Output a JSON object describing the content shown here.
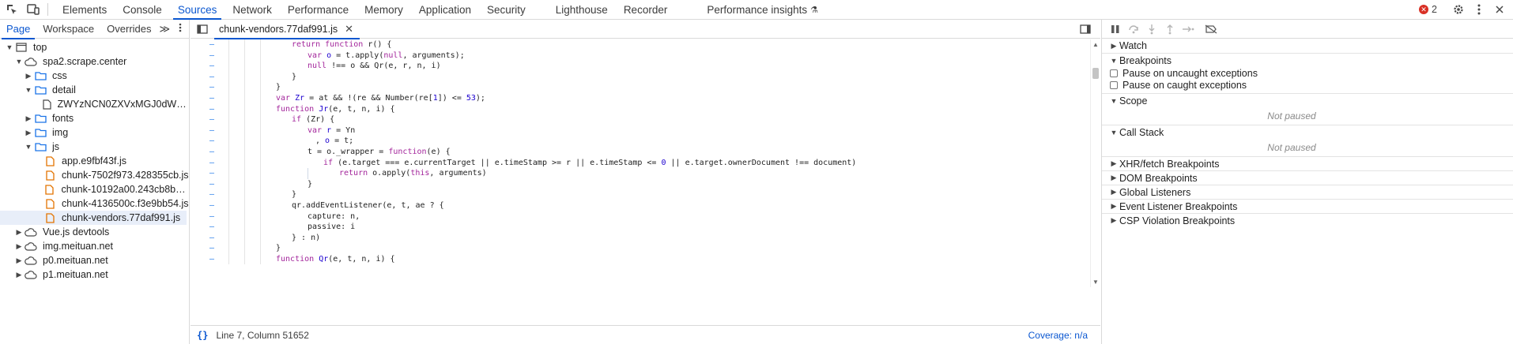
{
  "toolbar": {
    "inspect_icon": "inspect-element-icon",
    "device_icon": "device-toggle-icon"
  },
  "tabs": [
    {
      "label": "Elements"
    },
    {
      "label": "Console"
    },
    {
      "label": "Sources"
    },
    {
      "label": "Network"
    },
    {
      "label": "Performance"
    },
    {
      "label": "Memory"
    },
    {
      "label": "Application"
    },
    {
      "label": "Security"
    },
    {
      "label": "Lighthouse"
    },
    {
      "label": "Recorder"
    },
    {
      "label": "Performance insights"
    }
  ],
  "active_tab": "Sources",
  "error_count": "2",
  "navigator": {
    "tabs": [
      "Page",
      "Workspace",
      "Overrides"
    ],
    "more": "≫",
    "tree": [
      {
        "label": "top",
        "depth": 0,
        "type": "frame",
        "expanded": true
      },
      {
        "label": "spa2.scrape.center",
        "depth": 1,
        "type": "cloud",
        "expanded": true
      },
      {
        "label": "css",
        "depth": 2,
        "type": "folder",
        "expanded": false
      },
      {
        "label": "detail",
        "depth": 2,
        "type": "folder",
        "expanded": true
      },
      {
        "label": "ZWYzNCN0ZXVxMGJ0dWEjKC01...",
        "depth": 3,
        "type": "page"
      },
      {
        "label": "fonts",
        "depth": 2,
        "type": "folder",
        "expanded": false
      },
      {
        "label": "img",
        "depth": 2,
        "type": "folder",
        "expanded": false
      },
      {
        "label": "js",
        "depth": 2,
        "type": "folder",
        "expanded": true
      },
      {
        "label": "app.e9fbf43f.js",
        "depth": 3,
        "type": "script"
      },
      {
        "label": "chunk-7502f973.428355cb.js",
        "depth": 3,
        "type": "script"
      },
      {
        "label": "chunk-10192a00.243cb8b7.js",
        "depth": 3,
        "type": "script"
      },
      {
        "label": "chunk-4136500c.f3e9bb54.js",
        "depth": 3,
        "type": "script"
      },
      {
        "label": "chunk-vendors.77daf991.js",
        "depth": 3,
        "type": "script",
        "selected": true
      },
      {
        "label": "Vue.js devtools",
        "depth": 1,
        "type": "cloud",
        "expanded": false
      },
      {
        "label": "img.meituan.net",
        "depth": 1,
        "type": "cloud",
        "expanded": false
      },
      {
        "label": "p0.meituan.net",
        "depth": 1,
        "type": "cloud",
        "expanded": false
      },
      {
        "label": "p1.meituan.net",
        "depth": 1,
        "type": "cloud",
        "expanded": false
      }
    ]
  },
  "editor": {
    "open_file": "chunk-vendors.77daf991.js",
    "gutter_mark": "–",
    "status": {
      "braces": "{}",
      "position": "Line 7, Column 51652",
      "coverage": "Coverage: n/a"
    }
  },
  "debugger": {
    "sections": {
      "watch": "Watch",
      "breakpoints": "Breakpoints",
      "pause_uncaught": "Pause on uncaught exceptions",
      "pause_caught": "Pause on caught exceptions",
      "scope": "Scope",
      "scope_status": "Not paused",
      "call_stack": "Call Stack",
      "call_stack_status": "Not paused",
      "xhr": "XHR/fetch Breakpoints",
      "dom": "DOM Breakpoints",
      "global": "Global Listeners",
      "event": "Event Listener Breakpoints",
      "csp": "CSP Violation Breakpoints"
    }
  },
  "colors": {
    "accent": "#0b57d0",
    "keyword": "#a3259b",
    "number": "#1c00cf",
    "folder": "#1a73e8",
    "script": "#e37400",
    "error": "#d93025"
  }
}
